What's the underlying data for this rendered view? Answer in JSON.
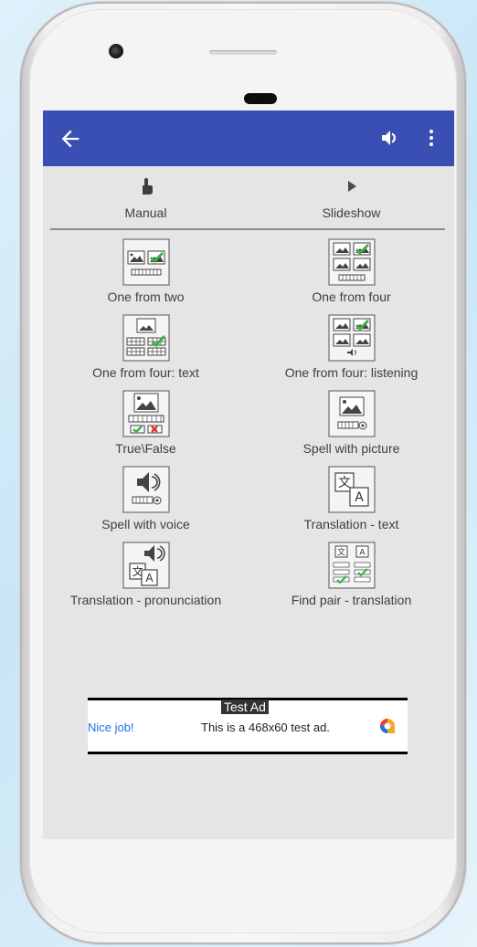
{
  "tabs": [
    {
      "label": "Manual",
      "icon": "touch-icon"
    },
    {
      "label": "Slideshow",
      "icon": "play-icon"
    }
  ],
  "exercises": [
    {
      "label": "One from two",
      "icon": "one-from-two-icon"
    },
    {
      "label": "One from four",
      "icon": "one-from-four-icon"
    },
    {
      "label": "One from four: text",
      "icon": "one-from-four-text-icon"
    },
    {
      "label": "One from four: listening",
      "icon": "one-from-four-listening-icon"
    },
    {
      "label": "True\\False",
      "icon": "true-false-icon"
    },
    {
      "label": "Spell with picture",
      "icon": "spell-with-picture-icon"
    },
    {
      "label": "Spell with voice",
      "icon": "spell-with-voice-icon"
    },
    {
      "label": "Translation - text",
      "icon": "translation-text-icon"
    },
    {
      "label": "Translation - pronunciation",
      "icon": "translation-pronunciation-icon"
    },
    {
      "label": "Find pair - translation",
      "icon": "find-pair-translation-icon"
    }
  ],
  "ad": {
    "tag": "Test Ad",
    "left_text": "Nice job!",
    "body": "This is a 468x60 test ad."
  },
  "colors": {
    "appbar": "#3a4fb3",
    "accent_check": "#3cb043",
    "wrong": "#d9342b"
  }
}
